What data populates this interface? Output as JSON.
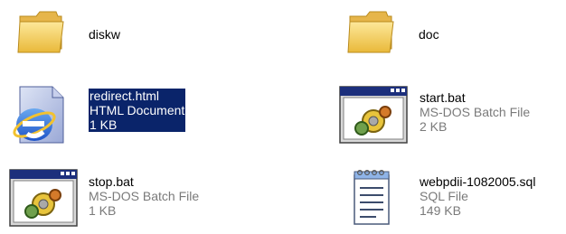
{
  "files": [
    {
      "name": "diskw",
      "type": "",
      "size": "",
      "icon": "folder-icon"
    },
    {
      "name": "doc",
      "type": "",
      "size": "",
      "icon": "folder-icon"
    },
    {
      "name": "redirect.html",
      "type": "HTML Document",
      "size": "1 KB",
      "icon": "ie-html-icon",
      "selected": true
    },
    {
      "name": "start.bat",
      "type": "MS-DOS Batch File",
      "size": "2 KB",
      "icon": "batch-file-icon"
    },
    {
      "name": "stop.bat",
      "type": "MS-DOS Batch File",
      "size": "1 KB",
      "icon": "batch-file-icon"
    },
    {
      "name": "webpdii-1082005.sql",
      "type": "SQL File",
      "size": "149 KB",
      "icon": "notepad-icon"
    }
  ],
  "colors": {
    "selection": "#0a246a",
    "secondary_text": "#7a7a7a",
    "folder": "#f6d66a"
  }
}
